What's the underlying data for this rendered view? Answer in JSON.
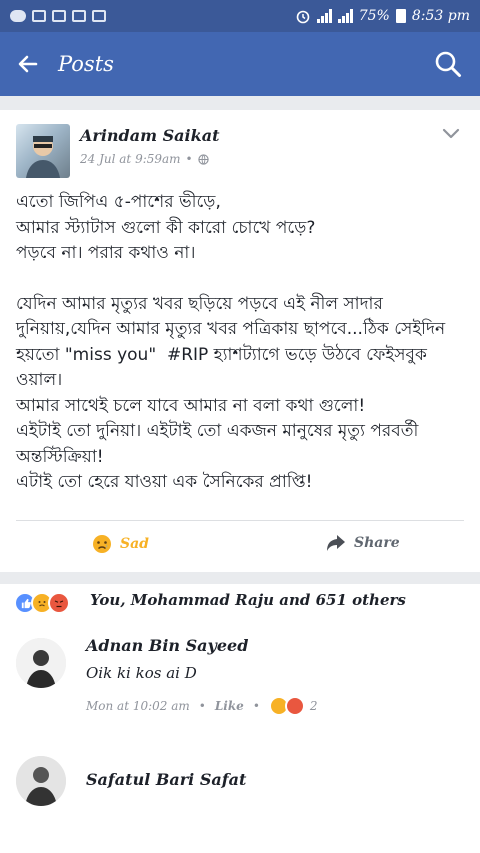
{
  "status_bar": {
    "battery": "75%",
    "time": "8:53 pm"
  },
  "app_bar": {
    "title": "Posts",
    "back_icon": "arrow-left-icon",
    "search_icon": "search-icon"
  },
  "post": {
    "author": "Arindam Saikat",
    "timestamp": "24 Jul at 9:59am",
    "privacy_icon": "globe-icon",
    "paragraphs": [
      "এতো জিপিএ ৫-পাশের ভীড়ে,\nআমার স্ট্যাটাস গুলো কী কারো চোখে পড়ে?\nপড়বে না। পরার কথাও না।",
      "যেদিন আমার মৃত্যুর খবর ছড়িয়ে পড়বে এই নীল সাদার দুনিয়ায়,যেদিন আমার মৃত্যুর খবর পত্রিকায় ছাপবে...ঠিক সেইদিন হয়তো \"miss you\"  #RIP হ্যাশট্যাগে ভড়ে উঠবে ফেইসবুক ওয়াল।\nআমার সাথেই চলে যাবে আমার না বলা কথা গুলো!\nএইটাই তো দুনিয়া। এইটাই তো একজন মানুষের মৃত্যু পরবর্তী অন্তস্টিক্রিয়া!\nএটাই তো হেরে যাওয়া এক সৈনিকের প্রাপ্তি!"
    ],
    "actions": {
      "sad_label": "Sad",
      "share_label": "Share"
    }
  },
  "reactions": {
    "summary": "You, Mohammad Raju and 651 others"
  },
  "comments": [
    {
      "name": "Adnan Bin Sayeed",
      "text": "Oik ki kos ai D",
      "time": "Mon at 10:02 am",
      "like_label": "Like",
      "reaction_count": "2"
    },
    {
      "name": "Safatul Bari Safat"
    }
  ],
  "colors": {
    "facebook_blue": "#4267b2",
    "status_bar": "#3b5998",
    "sad_yellow": "#f7b125",
    "like_blue": "#5890ff",
    "angry_red": "#e9573f"
  }
}
